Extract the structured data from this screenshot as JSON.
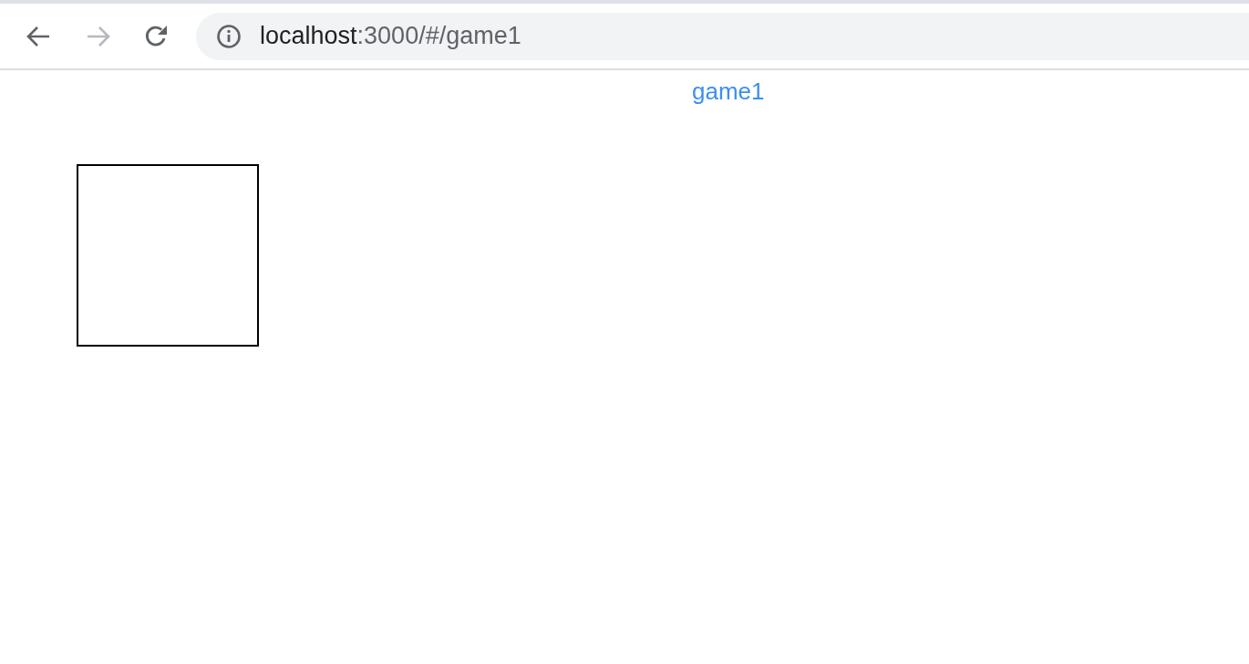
{
  "toolbar": {
    "back": {
      "disabled": false
    },
    "forward": {
      "disabled": true
    }
  },
  "address_bar": {
    "host": "localhost",
    "path": ":3000/#/game1"
  },
  "page": {
    "link": "game1"
  }
}
